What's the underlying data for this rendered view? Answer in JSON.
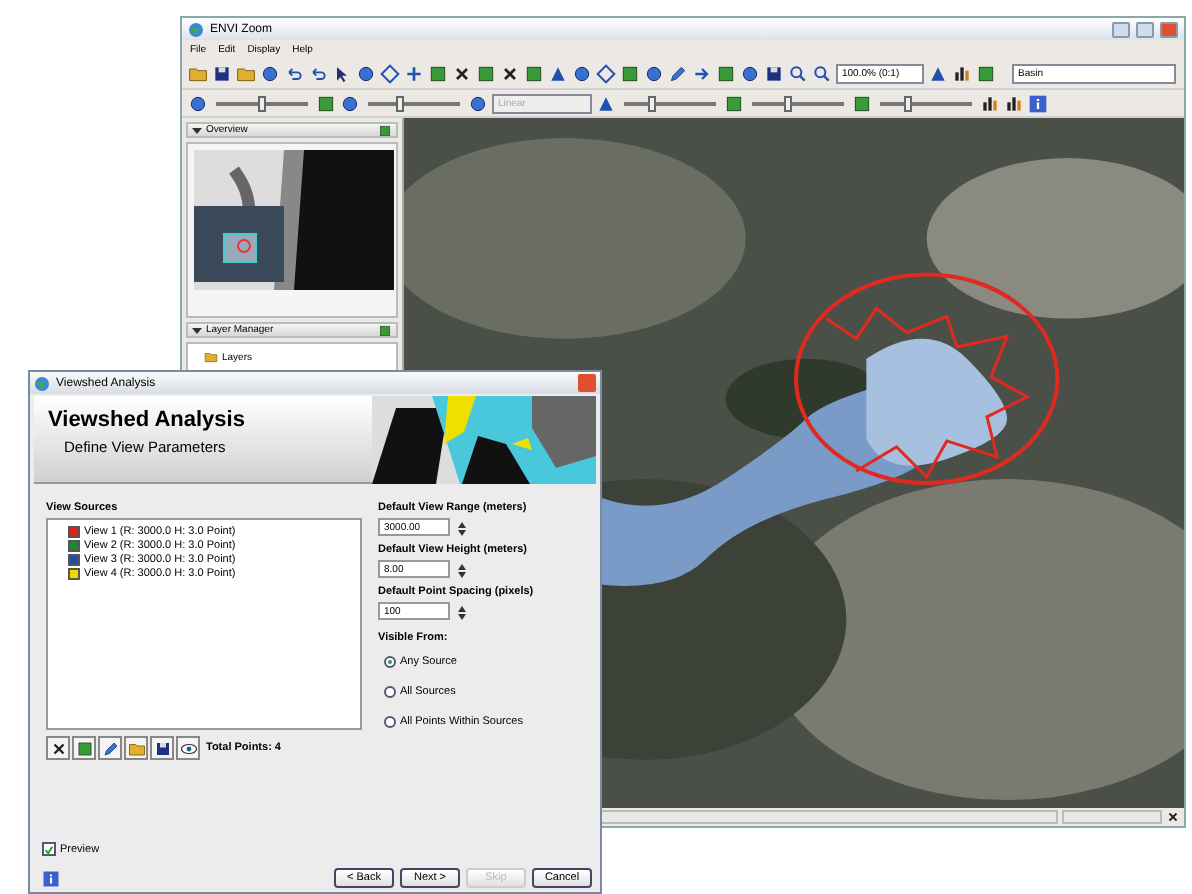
{
  "main_window": {
    "title": "ENVI Zoom",
    "menu": [
      "File",
      "Edit",
      "Display",
      "Help"
    ],
    "zoom_field": {
      "value": "100.0% (0:1)"
    },
    "layer_field": {
      "value": "Basin"
    },
    "stretch_field": {
      "value": "Linear",
      "disabled": true
    },
    "sliders": [
      {
        "level": 0.5
      },
      {
        "level": 0.35
      },
      {
        "level": 0.3
      },
      {
        "level": 0.4
      },
      {
        "level": 0.3
      }
    ],
    "panels": [
      {
        "title": "Overview"
      },
      {
        "title": "Layer Manager"
      }
    ],
    "layers": [
      "Layers"
    ]
  },
  "dialog": {
    "title": "Viewshed Analysis",
    "heading": "Viewshed Analysis",
    "subheading": "Define View Parameters",
    "sources_label": "View Sources",
    "sources": [
      {
        "label": "View 1 (R: 3000.0 H: 3.0 Point)",
        "color": "#e02020"
      },
      {
        "label": "View 2 (R: 3000.0 H: 3.0 Point)",
        "color": "#1a8a3a"
      },
      {
        "label": "View 3 (R: 3000.0 H: 3.0 Point)",
        "color": "#2a4aa8"
      },
      {
        "label": "View 4 (R: 3000.0 H: 3.0 Point)",
        "color": "#f0d800"
      }
    ],
    "total_points": "Total Points: 4",
    "fields": [
      {
        "label": "Default View Range (meters)",
        "value": "3000.00"
      },
      {
        "label": "Default View Height (meters)",
        "value": "8.00"
      },
      {
        "label": "Default Point Spacing (pixels)",
        "value": "100"
      }
    ],
    "visible_from_label": "Visible From:",
    "visible_from": [
      {
        "label": "Any Source",
        "selected": true
      },
      {
        "label": "All Sources",
        "selected": false
      },
      {
        "label": "All Points Within Sources",
        "selected": false
      }
    ],
    "preview": {
      "label": "Preview",
      "checked": true
    },
    "buttons": [
      {
        "label": "< Back",
        "disabled": false
      },
      {
        "label": "Next >",
        "disabled": false
      },
      {
        "label": "Skip",
        "disabled": true
      },
      {
        "label": "Cancel",
        "disabled": false
      }
    ]
  }
}
